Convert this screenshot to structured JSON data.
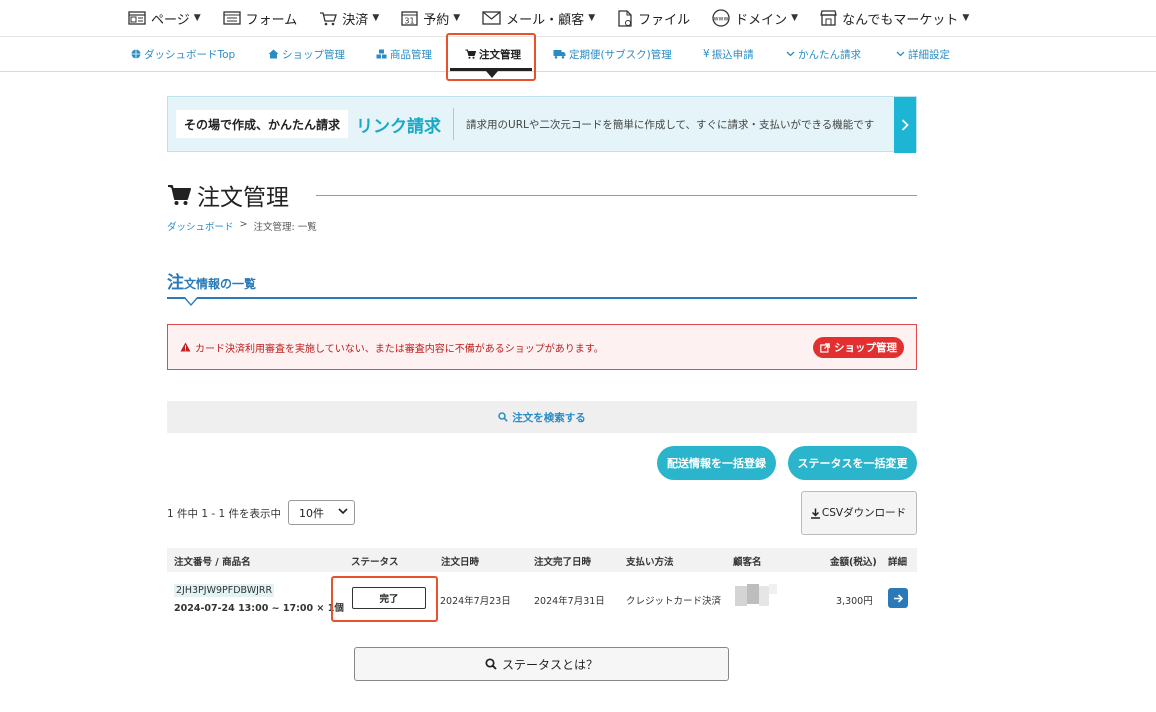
{
  "topnav": {
    "items": [
      {
        "label": "ページ",
        "icon": "page-icon"
      },
      {
        "label": "フォーム",
        "icon": "form-icon"
      },
      {
        "label": "決済",
        "icon": "cart-icon"
      },
      {
        "label": "予約",
        "icon": "calendar-icon",
        "icon_text": "31"
      },
      {
        "label": "メール・顧客",
        "icon": "mail-icon"
      },
      {
        "label": "ファイル",
        "icon": "file-icon"
      },
      {
        "label": "ドメイン",
        "icon": "www-icon",
        "icon_text": "www"
      },
      {
        "label": "なんでもマーケット",
        "icon": "shop-icon"
      }
    ]
  },
  "subnav": {
    "items": [
      {
        "label": "ダッシュボードTop",
        "icon": "globe-icon"
      },
      {
        "label": "ショップ管理",
        "icon": "home-icon"
      },
      {
        "label": "商品管理",
        "icon": "cubes-icon"
      },
      {
        "label": "注文管理",
        "icon": "cart-icon",
        "active": true
      },
      {
        "label": "定期便(サブスク)管理",
        "icon": "truck-icon"
      },
      {
        "label": "振込申請",
        "icon": "yen-icon",
        "icon_text": "¥"
      },
      {
        "label": "かんたん請求",
        "icon": "chevron-down-icon"
      },
      {
        "label": "詳細設定",
        "icon": "chevron-down-icon"
      }
    ]
  },
  "banner": {
    "tag": "その場で作成、かんたん請求",
    "title": "リンク請求",
    "description": "請求用のURLや二次元コードを簡単に作成して、すぐに請求・支払いができる機能です"
  },
  "page": {
    "title": "注文管理",
    "breadcrumb": {
      "home": "ダッシュボード",
      "sep": ">",
      "current": "注文管理: 一覧"
    },
    "section_first": "注",
    "section_rest": "文情報の一覧"
  },
  "alert": {
    "message": "カード決済利用審査を実施していない、または審査内容に不備があるショップがあります。",
    "button": "ショップ管理"
  },
  "search": {
    "label": "注文を検索する"
  },
  "actions": {
    "bulk_shipping": "配送情報を一括登録",
    "bulk_status": "ステータスを一括変更"
  },
  "listing": {
    "count_text": "1 件中 1 - 1 件を表示中",
    "per_page": "10件",
    "csv_label": "CSVダウンロード"
  },
  "table": {
    "headers": [
      "注文番号 / 商品名",
      "ステータス",
      "注文日時",
      "注文完了日時",
      "支払い方法",
      "顧客名",
      "金額(税込)",
      "詳細"
    ],
    "rows": [
      {
        "order_no": "2JH3PJW9PFDBWJRR",
        "product": "2024-07-24 13:00 ~ 17:00 × 1個",
        "status": "完了",
        "order_date": "2024年7月23日",
        "complete_date": "2024年7月31日",
        "payment": "クレジットカード決済",
        "amount": "3,300円"
      }
    ]
  },
  "footer": {
    "status_help": "ステータスとは？"
  },
  "colors": {
    "accent": "#2a8cc6",
    "teal": "#2ab5cc",
    "highlight": "#e5522c",
    "alert": "#e23030"
  }
}
